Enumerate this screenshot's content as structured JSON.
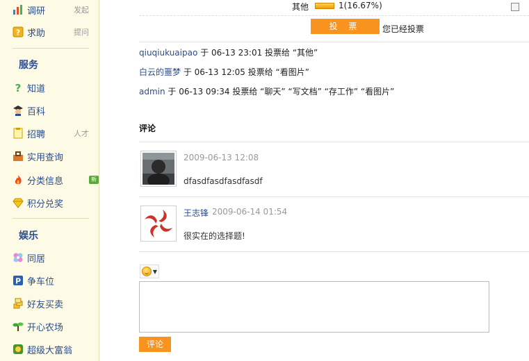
{
  "sidebar": {
    "items_top": [
      {
        "label": "调研",
        "aside": "发起",
        "icon": "bar-chart-icon"
      },
      {
        "label": "求助",
        "aside": "提问",
        "icon": "help-icon"
      }
    ],
    "section_service": "服务",
    "items_service": [
      {
        "label": "知道",
        "icon": "question-mark-icon"
      },
      {
        "label": "百科",
        "icon": "scholar-icon"
      },
      {
        "label": "招聘",
        "aside": "人才",
        "icon": "notepad-icon"
      },
      {
        "label": "实用查询",
        "icon": "toolbox-icon"
      },
      {
        "label": "分类信息",
        "icon": "fire-icon",
        "badge": "新"
      },
      {
        "label": "积分兑奖",
        "icon": "diamond-icon"
      }
    ],
    "section_fun": "娱乐",
    "items_fun": [
      {
        "label": "同居",
        "icon": "flower-icon"
      },
      {
        "label": "争车位",
        "icon": "parking-icon"
      },
      {
        "label": "好友买卖",
        "icon": "coins-icon"
      },
      {
        "label": "开心农场",
        "icon": "sprout-icon"
      },
      {
        "label": "超级大富翁",
        "icon": "money-icon"
      }
    ]
  },
  "poll": {
    "option_label": "其他",
    "option_result": "1(16.67%)",
    "vote_button": "投 票",
    "voted_text": "您已经投票"
  },
  "vote_log": [
    {
      "user": "qiuqiukuaipao",
      "mid": " 于 06-13 23:01 投票给 ",
      "choices": "“其他”"
    },
    {
      "user": "白云的噩梦",
      "mid": " 于 06-13 12:05 投票给 ",
      "choices": "“看图片”"
    },
    {
      "user": "admin",
      "mid": " 于 06-13 09:34 投票给 ",
      "choices": "“聊天” “写文档” “存工作” “看图片”"
    }
  ],
  "comments_heading": "评论",
  "comments": [
    {
      "author": "",
      "time": "2009-06-13 12:08",
      "text": "dfasdfasdfasdfasdf"
    },
    {
      "author": "王志锋",
      "time": "2009-06-14 01:54",
      "text": "很实在的选择题!"
    }
  ],
  "comment_form": {
    "submit_label": "评论",
    "textarea_value": ""
  },
  "colors": {
    "accent_orange": "#f7931e",
    "link_blue": "#2b4d8c",
    "sidebar_bg": "#fdfbe6"
  }
}
